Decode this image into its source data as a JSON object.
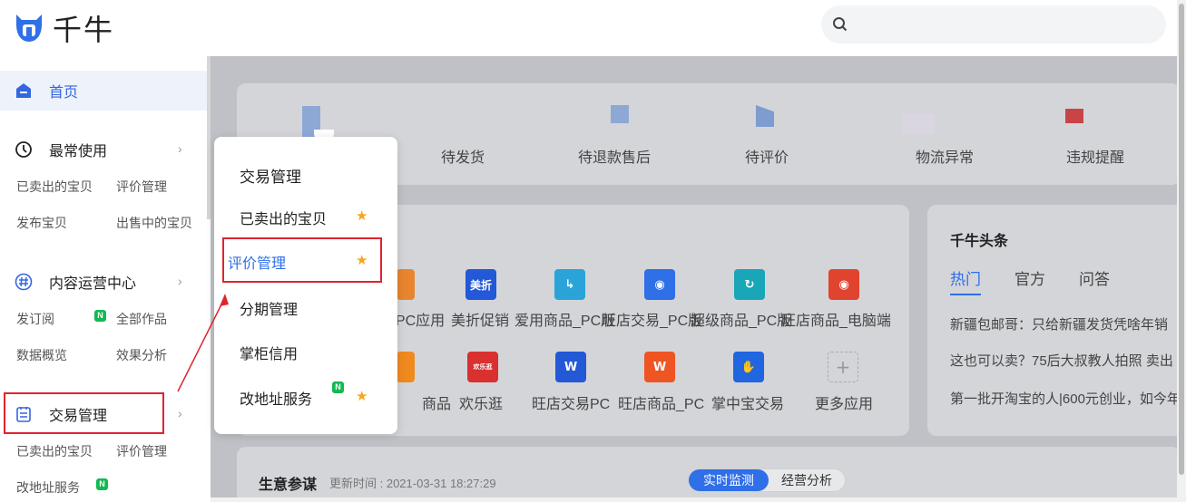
{
  "brand": {
    "name": "千牛",
    "accent": "#2f6fe8"
  },
  "search": {
    "placeholder": ""
  },
  "sidebar": {
    "home": {
      "label": "首页",
      "icon": "home-icon"
    },
    "groups": [
      {
        "label": "最常使用",
        "icon": "clock-icon",
        "links": [
          "已卖出的宝贝",
          "评价管理",
          "发布宝贝",
          "出售中的宝贝"
        ]
      },
      {
        "label": "内容运营中心",
        "icon": "hash-icon",
        "links": [
          "发订阅",
          "全部作品",
          "数据概览",
          "效果分析"
        ]
      },
      {
        "label": "交易管理",
        "icon": "clipboard-icon",
        "links": [
          "已卖出的宝贝",
          "评价管理",
          "改地址服务"
        ]
      }
    ],
    "chevron": "›",
    "badge": "N"
  },
  "stats": [
    "待发货",
    "待退款售后",
    "待评价",
    "物流异常",
    "违规提醒"
  ],
  "apps": {
    "row1": [
      "_PC应用",
      "美折促销",
      "爱用商品_PC版",
      "旺店交易_PC版",
      "超级商品_PC版",
      "旺店商品_电脑端"
    ],
    "row1_overlap": [
      "旺店交易_PC版",
      "超级商品_PC版",
      "旺店商品_电脑端"
    ],
    "row2": [
      "商品",
      "欢乐逛",
      "旺店交易PC",
      "旺店商品_PC",
      "掌中宝交易",
      "更多应用"
    ],
    "icon_text": {
      "meizhe": "美折",
      "huanle": "欢乐逛",
      "plus": "+"
    }
  },
  "news": {
    "title": "千牛头条",
    "tabs": [
      "热门",
      "官方",
      "问答"
    ],
    "lines": [
      "新疆包邮哥：只给新疆发货凭啥年销",
      "这也可以卖？75后大叔教人拍照 卖出",
      "第一批开淘宝的人|600元创业，如今年"
    ]
  },
  "business": {
    "title": "生意参谋",
    "updated": "更新时间 : 2021-03-31 18:27:29",
    "toggle_on": "实时监测",
    "toggle_off": "经营分析"
  },
  "popup": {
    "title": "交易管理",
    "items": [
      "已卖出的宝贝",
      "评价管理",
      "分期管理",
      "掌柜信用",
      "改地址服务"
    ]
  },
  "colors": {
    "highlight_box": "#e0242e",
    "star": "#f7a51c",
    "badge": "#13b954"
  }
}
